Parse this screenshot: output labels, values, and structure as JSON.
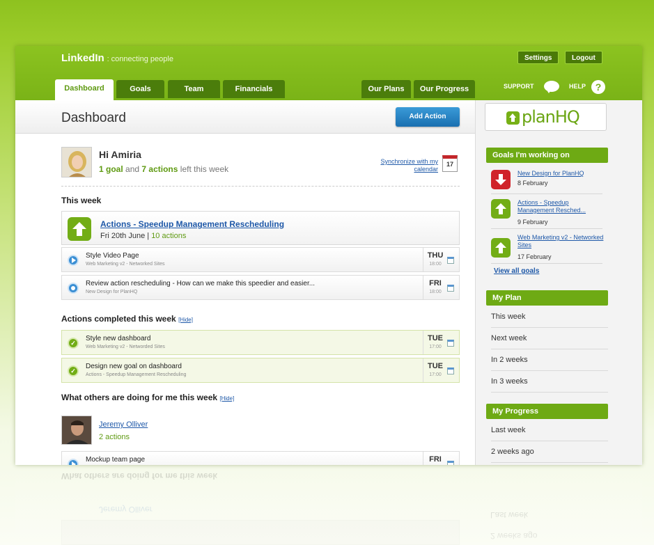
{
  "header": {
    "brand_name": "LinkedIn",
    "brand_tagline": ": connecting people",
    "settings_label": "Settings",
    "logout_label": "Logout",
    "support_label": "SUPPORT",
    "help_label": "HELP",
    "help_glyph": "?"
  },
  "tabs": {
    "left": [
      "Dashboard",
      "Goals",
      "Team",
      "Financials"
    ],
    "right": [
      "Our Plans",
      "Our Progress"
    ],
    "active": "Dashboard"
  },
  "titlebar": {
    "page_title": "Dashboard",
    "add_action_label": "Add Action"
  },
  "logo": {
    "text": "planHQ"
  },
  "greeting": {
    "hi": "Hi Amiria",
    "goal_count": "1 goal",
    "and": "and",
    "action_count": "7 actions",
    "left_text": "left this week",
    "sync_link": "Synchronize with my calendar",
    "calendar_day": "17"
  },
  "this_week": {
    "heading": "This week",
    "focus": {
      "title": "Actions - Speedup Management Rescheduling",
      "date": "Fri 20th June |",
      "actions": "10 actions"
    },
    "actions": [
      {
        "title": "Style Video Page",
        "subtitle": "Web Marketing v2 - Networked Sites",
        "day": "THU",
        "time": "18:00",
        "icon": "play-icon"
      },
      {
        "title": "Review action rescheduling - How can we make this speedier and easier...",
        "subtitle": "New Design for PlanHQ",
        "day": "FRI",
        "time": "18:00",
        "icon": "circle-icon"
      }
    ]
  },
  "completed": {
    "heading": "Actions completed this week",
    "hide_label": "[Hide]",
    "actions": [
      {
        "title": "Style new dashboard",
        "subtitle": "Web Marketing v2 - Networded Sites",
        "day": "TUE",
        "time": "17:00",
        "icon": "check-icon"
      },
      {
        "title": "Design new goal on dashboard",
        "subtitle": "Actions - Speedup Management Rescheduling",
        "day": "TUE",
        "time": "17:00",
        "icon": "check-icon"
      }
    ]
  },
  "others": {
    "heading": "What others are doing for me this week",
    "hide_label": "[Hide]",
    "person_name": "Jeremy Olliver",
    "person_actions": "2 actions",
    "actions": [
      {
        "title": "Mockup team page",
        "day": "FRI"
      }
    ]
  },
  "sidebar": {
    "goals_heading": "Goals I'm working on",
    "goals": [
      {
        "title": "New Design for PlanHQ",
        "date": "8 February",
        "direction": "down"
      },
      {
        "title": "Actions - Speedup Management Resched...",
        "date": "9 February",
        "direction": "up"
      },
      {
        "title": "Web Marketing v2 - Networked Sites",
        "date": "17 February",
        "direction": "up"
      }
    ],
    "view_all": "View all goals",
    "plan_heading": "My Plan",
    "plan_items": [
      "This week",
      "Next week",
      "In 2 weeks",
      "In 3 weeks"
    ],
    "progress_heading": "My Progress",
    "progress_items": [
      "Last week",
      "2 weeks ago"
    ]
  },
  "colors": {
    "brand_green": "#7ab317",
    "dark_tab_green": "#4b7d0b",
    "link_blue": "#1e58a8",
    "button_blue": "#1a6fb0",
    "alert_red": "#d0232a"
  }
}
